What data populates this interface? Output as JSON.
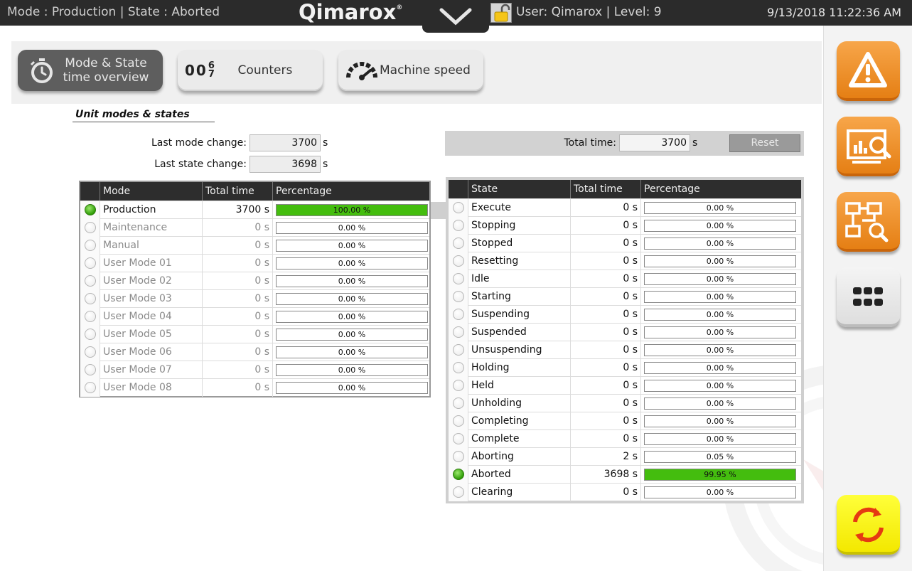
{
  "topbar": {
    "mode_state": "Mode : Production  |  State : Aborted",
    "logo_text": "Qimarox",
    "logo_reg": "®",
    "user": "User: Qimarox  |  Level: 9",
    "datetime": "9/13/2018 11:22:36 AM"
  },
  "tabs": {
    "mode_state_label_1": "Mode & State",
    "mode_state_label_2": "time overview",
    "counters_label": "Counters",
    "machine_speed_label": "Machine speed",
    "counter_icon_digits": "00",
    "counter_icon_top": "6",
    "counter_icon_bottom": "7"
  },
  "section": {
    "title": "Unit modes & states",
    "last_mode_change_label": "Last mode change:",
    "last_mode_change_value": "3700",
    "last_state_change_label": "Last state change:",
    "last_state_change_value": "3698",
    "total_time_label": "Total time:",
    "total_time_value": "3700",
    "unit": "s",
    "reset_label": "Reset"
  },
  "mode_table": {
    "headers": [
      "Mode",
      "Total time",
      "Percentage"
    ],
    "rows": [
      {
        "name": "Production",
        "time": "3700 s",
        "pct": "100.00 %",
        "fraction": 1.0,
        "active": true
      },
      {
        "name": "Maintenance",
        "time": "0 s",
        "pct": "0.00 %",
        "fraction": 0,
        "active": false
      },
      {
        "name": "Manual",
        "time": "0 s",
        "pct": "0.00 %",
        "fraction": 0,
        "active": false
      },
      {
        "name": "User Mode 01",
        "time": "0 s",
        "pct": "0.00 %",
        "fraction": 0,
        "active": false
      },
      {
        "name": "User Mode 02",
        "time": "0 s",
        "pct": "0.00 %",
        "fraction": 0,
        "active": false
      },
      {
        "name": "User Mode 03",
        "time": "0 s",
        "pct": "0.00 %",
        "fraction": 0,
        "active": false
      },
      {
        "name": "User Mode 04",
        "time": "0 s",
        "pct": "0.00 %",
        "fraction": 0,
        "active": false
      },
      {
        "name": "User Mode 05",
        "time": "0 s",
        "pct": "0.00 %",
        "fraction": 0,
        "active": false
      },
      {
        "name": "User Mode 06",
        "time": "0 s",
        "pct": "0.00 %",
        "fraction": 0,
        "active": false
      },
      {
        "name": "User Mode 07",
        "time": "0 s",
        "pct": "0.00 %",
        "fraction": 0,
        "active": false
      },
      {
        "name": "User Mode 08",
        "time": "0 s",
        "pct": "0.00 %",
        "fraction": 0,
        "active": false
      }
    ]
  },
  "state_table": {
    "headers": [
      "State",
      "Total time",
      "Percentage"
    ],
    "rows": [
      {
        "name": "Execute",
        "time": "0 s",
        "pct": "0.00 %",
        "fraction": 0,
        "active": false
      },
      {
        "name": "Stopping",
        "time": "0 s",
        "pct": "0.00 %",
        "fraction": 0,
        "active": false
      },
      {
        "name": "Stopped",
        "time": "0 s",
        "pct": "0.00 %",
        "fraction": 0,
        "active": false
      },
      {
        "name": "Resetting",
        "time": "0 s",
        "pct": "0.00 %",
        "fraction": 0,
        "active": false
      },
      {
        "name": "Idle",
        "time": "0 s",
        "pct": "0.00 %",
        "fraction": 0,
        "active": false
      },
      {
        "name": "Starting",
        "time": "0 s",
        "pct": "0.00 %",
        "fraction": 0,
        "active": false
      },
      {
        "name": "Suspending",
        "time": "0 s",
        "pct": "0.00 %",
        "fraction": 0,
        "active": false
      },
      {
        "name": "Suspended",
        "time": "0 s",
        "pct": "0.00 %",
        "fraction": 0,
        "active": false
      },
      {
        "name": "Unsuspending",
        "time": "0 s",
        "pct": "0.00 %",
        "fraction": 0,
        "active": false
      },
      {
        "name": "Holding",
        "time": "0 s",
        "pct": "0.00 %",
        "fraction": 0,
        "active": false
      },
      {
        "name": "Held",
        "time": "0 s",
        "pct": "0.00 %",
        "fraction": 0,
        "active": false
      },
      {
        "name": "Unholding",
        "time": "0 s",
        "pct": "0.00 %",
        "fraction": 0,
        "active": false
      },
      {
        "name": "Completing",
        "time": "0 s",
        "pct": "0.00 %",
        "fraction": 0,
        "active": false
      },
      {
        "name": "Complete",
        "time": "0 s",
        "pct": "0.00 %",
        "fraction": 0,
        "active": false
      },
      {
        "name": "Aborting",
        "time": "2 s",
        "pct": "0.05 %",
        "fraction": 0.0005,
        "active": false
      },
      {
        "name": "Aborted",
        "time": "3698 s",
        "pct": "99.95 %",
        "fraction": 0.9995,
        "active": true
      },
      {
        "name": "Clearing",
        "time": "0 s",
        "pct": "0.00 %",
        "fraction": 0,
        "active": false
      }
    ]
  },
  "sidebar": {
    "items": [
      "warning-icon",
      "report-chart-icon",
      "flow-diagram-icon",
      "apps-grid-icon",
      "refresh-icon"
    ]
  },
  "colors": {
    "accent_orange": "#e57f14",
    "active_green": "#44bd0e",
    "topbar_bg": "#2b2b2b",
    "refresh_yellow": "#f3e800"
  }
}
